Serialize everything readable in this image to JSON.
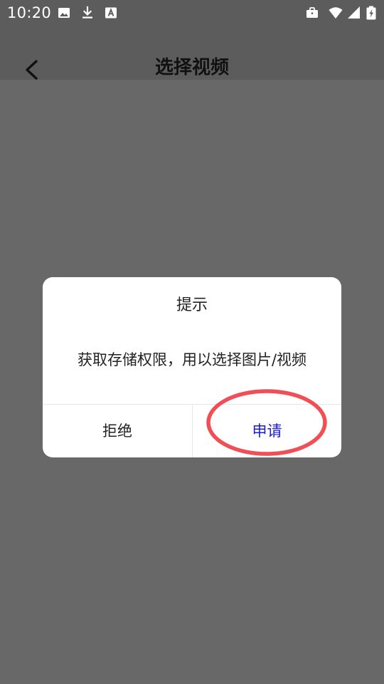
{
  "status_bar": {
    "time": "10:20",
    "left_icons": [
      "image-icon",
      "download-icon",
      "a-icon"
    ],
    "right_icons": [
      "briefcase-icon",
      "wifi-icon",
      "signal-icon",
      "battery-icon"
    ]
  },
  "header": {
    "title": "选择视频",
    "back_icon": "chevron-left-icon"
  },
  "dialog": {
    "title": "提示",
    "message": "获取存储权限，用以选择图片/视频",
    "reject_label": "拒绝",
    "apply_label": "申请"
  },
  "colors": {
    "overlay": "#686868",
    "dialog_bg": "#ffffff",
    "apply_text": "#1c1ccc",
    "highlight_ring": "#ef4f55"
  }
}
